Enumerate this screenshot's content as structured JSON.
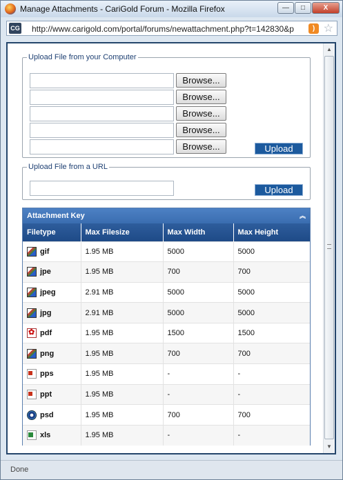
{
  "window": {
    "title": "Manage Attachments - CariGold Forum - Mozilla Firefox",
    "minimize": "—",
    "maximize": "□",
    "close": "X"
  },
  "urlbar": {
    "site_badge": "CG",
    "url": "http://www.carigold.com/portal/forums/newattachment.php?t=142830&p"
  },
  "upload_computer": {
    "legend": "Upload File from your Computer",
    "browse_label": "Browse...",
    "upload_label": "Upload"
  },
  "upload_url": {
    "legend": "Upload File from a URL",
    "upload_label": "Upload"
  },
  "attachment_key": {
    "title": "Attachment Key",
    "headers": [
      "Filetype",
      "Max Filesize",
      "Max Width",
      "Max Height"
    ],
    "rows": [
      {
        "type": "gif",
        "icon": "image-file-icon",
        "size": "1.95 MB",
        "width": "5000",
        "height": "5000"
      },
      {
        "type": "jpe",
        "icon": "image-file-icon",
        "size": "1.95 MB",
        "width": "700",
        "height": "700"
      },
      {
        "type": "jpeg",
        "icon": "image-file-icon",
        "size": "2.91 MB",
        "width": "5000",
        "height": "5000"
      },
      {
        "type": "jpg",
        "icon": "image-file-icon",
        "size": "2.91 MB",
        "width": "5000",
        "height": "5000"
      },
      {
        "type": "pdf",
        "icon": "pdf-file-icon",
        "size": "1.95 MB",
        "width": "1500",
        "height": "1500"
      },
      {
        "type": "png",
        "icon": "image-file-icon",
        "size": "1.95 MB",
        "width": "700",
        "height": "700"
      },
      {
        "type": "pps",
        "icon": "presentation-file-icon",
        "size": "1.95 MB",
        "width": "-",
        "height": "-"
      },
      {
        "type": "ppt",
        "icon": "presentation-file-icon",
        "size": "1.95 MB",
        "width": "-",
        "height": "-"
      },
      {
        "type": "psd",
        "icon": "photoshop-file-icon",
        "size": "1.95 MB",
        "width": "700",
        "height": "700"
      },
      {
        "type": "xls",
        "icon": "spreadsheet-file-icon",
        "size": "1.95 MB",
        "width": "-",
        "height": "-"
      }
    ]
  },
  "status": {
    "text": "Done"
  }
}
